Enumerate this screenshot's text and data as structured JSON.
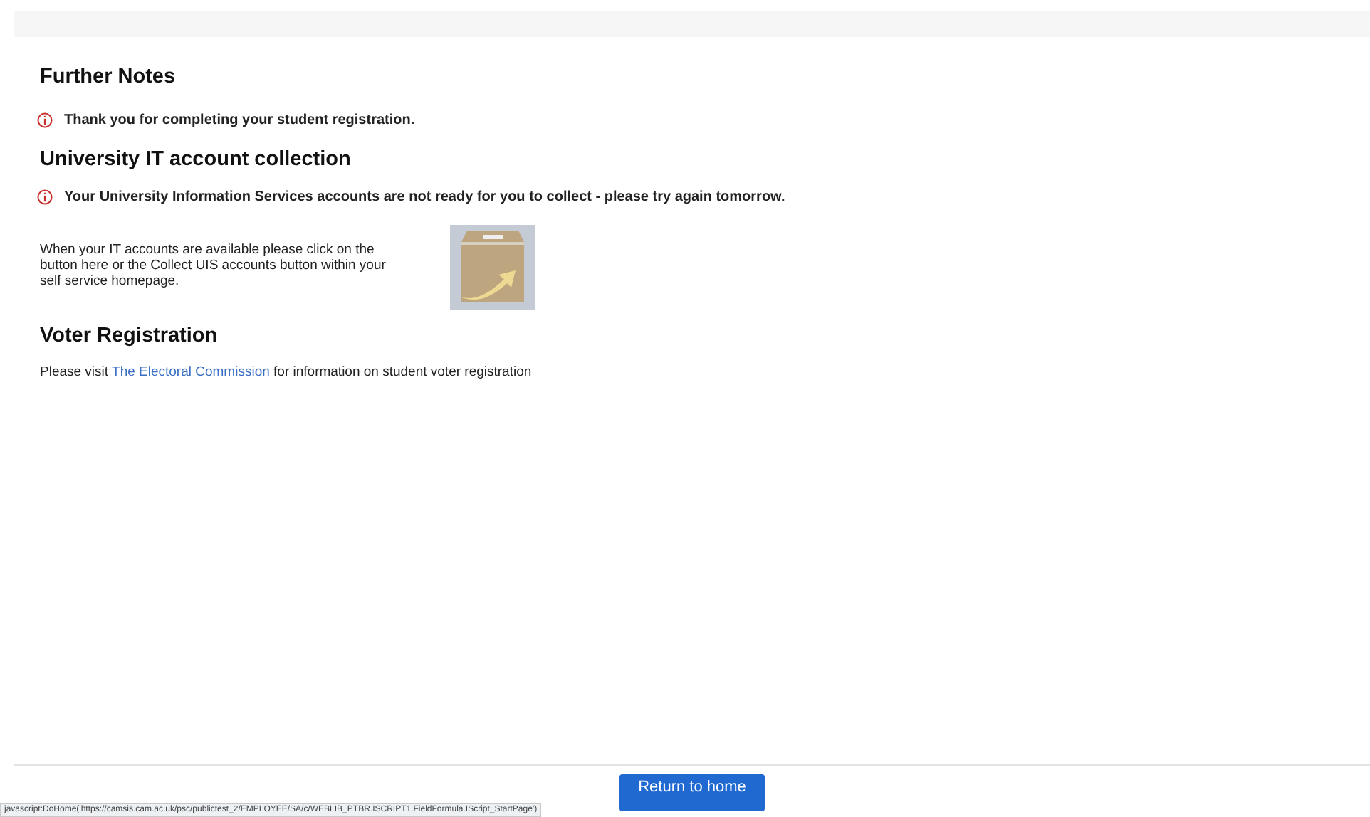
{
  "sections": [
    {
      "heading": "Further Notes",
      "notices": [
        "Thank you for completing your student registration."
      ]
    },
    {
      "heading": "University IT account collection",
      "notices": [
        "Your University Information Services accounts are not ready for you to collect - please try again tomorrow."
      ],
      "body": "When your IT accounts are available please click on the button here or the Collect UIS accounts button within your self service homepage."
    },
    {
      "heading": "Voter Registration",
      "sentence": {
        "before": "Please visit",
        "link": "The Electoral Commission",
        "after": "for information on student voter registration"
      }
    }
  ],
  "footer": {
    "button": "Return to home"
  },
  "status_bar": "javascript:DoHome('https://camsis.cam.ac.uk/psc/publictest_2/EMPLOYEE/SA/c/WEBLIB_PTBR.ISCRIPT1.FieldFormula.IScript_StartPage')"
}
